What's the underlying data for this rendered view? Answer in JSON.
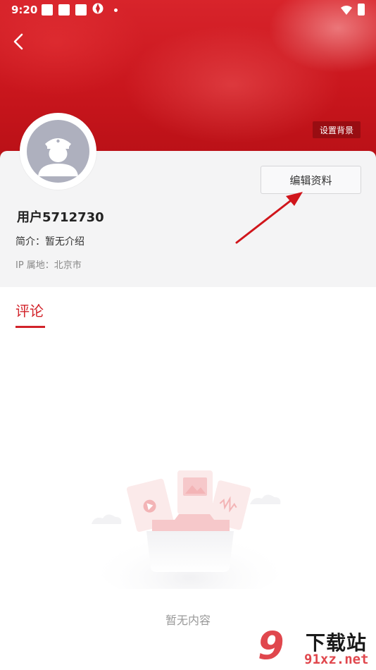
{
  "status_bar": {
    "time": "9:20",
    "icons": [
      "notification-square-icon",
      "notification-square-icon",
      "notification-square-icon",
      "sync-icon",
      "dot-icon",
      "wifi-icon",
      "battery-icon"
    ]
  },
  "header": {
    "back_icon": "chevron-left-icon",
    "set_background_label": "设置背景",
    "accent_color": "#d2232a"
  },
  "profile": {
    "avatar_icon": "default-user-avatar-icon",
    "edit_profile_label": "编辑资料",
    "username": "用户5712730",
    "bio": "简介：暂无介绍",
    "ip_location": "IP 属地：北京市"
  },
  "tabs": [
    {
      "label": "评论",
      "active": true
    }
  ],
  "empty_state": {
    "illustration": "empty-folder-illustration",
    "message": "暂无内容"
  },
  "watermark": {
    "logo": "9",
    "title": "下载站",
    "url": "91xz.net"
  }
}
